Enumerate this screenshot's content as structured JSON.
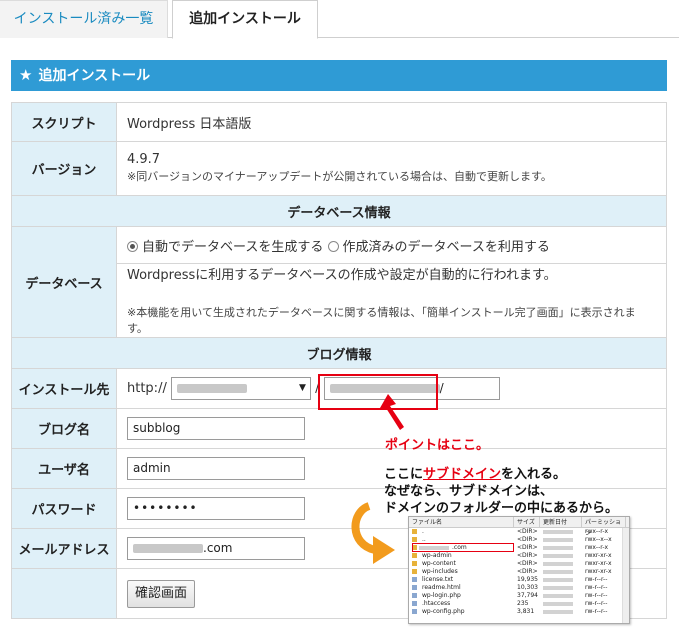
{
  "tabs": [
    {
      "label": "インストール済み一覧",
      "active": false
    },
    {
      "label": "追加インストール",
      "active": true
    }
  ],
  "section": {
    "icon": "star-icon",
    "title": "追加インストール"
  },
  "form": {
    "script": {
      "label": "スクリプト",
      "value": "Wordpress 日本語版"
    },
    "version": {
      "label": "バージョン",
      "value": "4.9.7",
      "note": "※同バージョンのマイナーアップデートが公開されている場合は、自動で更新します。"
    },
    "db_section": "データベース情報",
    "database": {
      "label": "データベース",
      "option_auto": "自動でデータベースを生成する",
      "option_existing": "作成済みのデータベースを利用する",
      "selected": "auto",
      "description": "Wordpressに利用するデータベースの作成や設定が自動的に行われます。",
      "note": "※本機能を用いて生成されたデータベースに関する情報は、「簡単インストール完了画面」に表示されます。"
    },
    "blog_section": "ブログ情報",
    "install_path": {
      "label": "インストール先",
      "protocol": "http://",
      "separator": "/",
      "trailing": "/"
    },
    "blog_name": {
      "label": "ブログ名",
      "value": "subblog"
    },
    "username": {
      "label": "ユーザ名",
      "value": "admin"
    },
    "password": {
      "label": "パスワード",
      "value": "••••••••"
    },
    "email": {
      "label": "メールアドレス",
      "suffix": ".com"
    },
    "confirm_button": "確認画面"
  },
  "annotations": {
    "point": "ポイントはここ。",
    "line1_prefix": "ここに",
    "line1_highlight": "サブドメイン",
    "line1_suffix": "を入れる。",
    "line2": "なぜなら、サブドメインは、",
    "line3": "ドメインのフォルダーの中にあるから。",
    "colors": {
      "red": "#e60012",
      "orange": "#f29b1d",
      "header_blue": "#2f9bd5"
    }
  },
  "filelist": {
    "headers": [
      "ファイル名",
      "サイズ",
      "更新日付",
      "パーミッション"
    ],
    "rows": [
      {
        "name": ".",
        "size": "<DIR>",
        "perm": "rwx--r-x"
      },
      {
        "name": "..",
        "size": "<DIR>",
        "perm": "rwx--x--x"
      },
      {
        "name": ".com",
        "size": "<DIR>",
        "perm": "rwx--r-x"
      },
      {
        "name": "wp-admin",
        "size": "<DIR>",
        "perm": "rwxr-xr-x"
      },
      {
        "name": "wp-content",
        "size": "<DIR>",
        "perm": "rwxr-xr-x"
      },
      {
        "name": "wp-includes",
        "size": "<DIR>",
        "perm": "rwxr-xr-x"
      },
      {
        "name": "license.txt",
        "size": "19,935",
        "perm": "rw-r--r--"
      },
      {
        "name": "readme.html",
        "size": "10,303",
        "perm": "rw-r--r--"
      },
      {
        "name": "wp-login.php",
        "size": "37,794",
        "perm": "rw-r--r--"
      },
      {
        "name": ".htaccess",
        "size": "235",
        "perm": "rw-r--r--"
      },
      {
        "name": "wp-config.php",
        "size": "3,831",
        "perm": "rw-r--r--"
      }
    ]
  }
}
